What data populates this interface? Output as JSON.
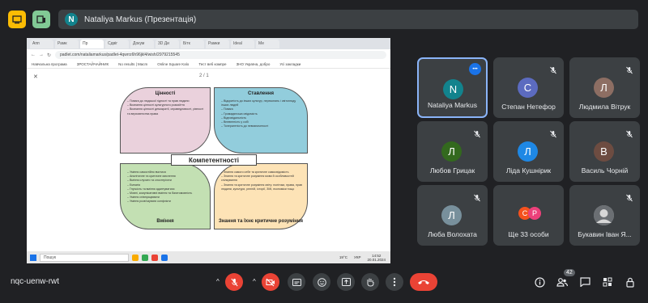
{
  "presenter": {
    "initial": "N",
    "label": "Nataliya Markus (Презентація)"
  },
  "browser": {
    "tabs": [
      "Апп",
      "Рамк",
      "Пр",
      "Сдвіг",
      "Докум",
      "3D Ди",
      "Бітк",
      "Рамки",
      "Ideal",
      "Ме"
    ],
    "url": "padlet.com/nataliamarkus/padlet-4qwrrz6h96jkl4/wish/2979215545",
    "bookmarks": [
      "Навчальна програма",
      "ЗРОСТАЙЧАЙНИК",
      "No results | Macm",
      "Online Square Kalo",
      "Тест веб компре",
      "ЗНО Україна, добро",
      "Усі закладки"
    ],
    "page_counter": "2 / 1"
  },
  "diagram": {
    "center": "Компетентності",
    "values": {
      "title": "Цінності",
      "items": [
        "Повага до людської гідності та прав людини",
        "Визнання цінності культурного розмаїття",
        "Визнання цінності демократії, справедливості, рівності та верховенства права"
      ]
    },
    "attitudes": {
      "title": "Ставлення",
      "items": [
        "Відкритість до інших культур, переконань і світогляду інших людей",
        "Повага",
        "Громадянська свідомість",
        "Відповідальність",
        "Впевненість у собі",
        "Толерантність до невизначеності"
      ]
    },
    "skills": {
      "title": "Вміння",
      "items": [
        "Уміння самостійно вчитися",
        "Аналітичне та критичне мислення",
        "Вміння слухати та спостерігати",
        "Емпатія",
        "Гнучкість та вміння адаптуватися",
        "Мовні, комунікативні вміння та багатомовність",
        "Уміння співпрацювати",
        "Уміння розв'язувати конфлікти"
      ]
    },
    "knowledge": {
      "title": "Знання та їхнє критичне розуміння",
      "items": [
        "Знання самого себе та критичне самосвідомість",
        "Знання та критичне розуміння мови й особливостей спілкування",
        "Знання та критичне розуміння світу: політики, права, прав людини, культури, релігій, історії, ЗМІ, економіки тощо"
      ]
    }
  },
  "taskbar": {
    "search": "Пошук",
    "temp": "19°C",
    "lang": "УКР",
    "time": "14:52",
    "date": "20.01.2024"
  },
  "participants": [
    {
      "name": "Nataliya Markus",
      "initial": "N",
      "color": "#12838d"
    },
    {
      "name": "Степан Нетефор",
      "initial": "С",
      "color": "#5c6bc0"
    },
    {
      "name": "Людмила Вітрук",
      "initial": "Л",
      "color": "#8d6e63"
    },
    {
      "name": "Любов Грицак",
      "initial": "Л",
      "color": "#33691e"
    },
    {
      "name": "Ліда Кушнірик",
      "initial": "Л",
      "color": "#1e88e5"
    },
    {
      "name": "Василь Чорній",
      "initial": "В",
      "color": "#6d4c41"
    },
    {
      "name": "Люба Волохата",
      "initial": "Л",
      "color": "#78909c"
    },
    {
      "name": "Ще 33 особи",
      "initial": "",
      "color": "#3c4043"
    },
    {
      "name": "Букавин Іван Я...",
      "initial": "",
      "color": "#3c4043"
    }
  ],
  "more_group": {
    "a": "С",
    "b": "Р",
    "a_color": "#f4511e",
    "b_color": "#ec407a"
  },
  "meeting_code": "nqc-uenw-rwt",
  "people_count": "42"
}
